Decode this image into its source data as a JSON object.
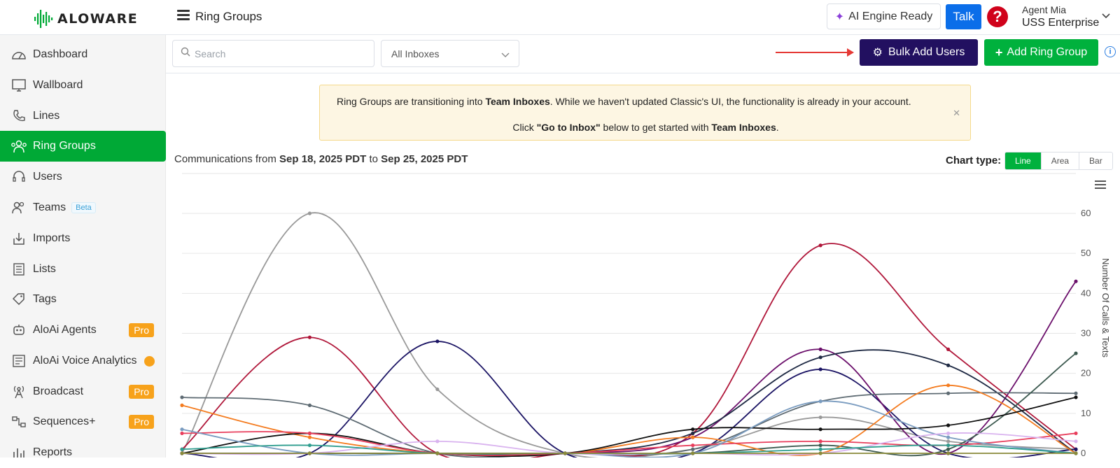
{
  "app": {
    "logo_text": "ALOWARE",
    "page_title": "Ring Groups"
  },
  "header": {
    "ai_status": "AI Engine Ready",
    "talk_label": "Talk",
    "agent_name": "Agent Mia",
    "agent_org": "USS Enterprise"
  },
  "sidebar": {
    "items": [
      {
        "label": "Dashboard",
        "icon": "dashboard-icon"
      },
      {
        "label": "Wallboard",
        "icon": "monitor-icon"
      },
      {
        "label": "Lines",
        "icon": "phone-icon"
      },
      {
        "label": "Ring Groups",
        "icon": "ring-groups-icon",
        "active": true
      },
      {
        "label": "Users",
        "icon": "headset-icon"
      },
      {
        "label": "Teams",
        "icon": "team-icon",
        "badge": "Beta"
      },
      {
        "label": "Imports",
        "icon": "import-icon"
      },
      {
        "label": "Lists",
        "icon": "list-icon"
      },
      {
        "label": "Tags",
        "icon": "tag-icon"
      },
      {
        "label": "AloAi Agents",
        "icon": "robot-icon",
        "badge": "Pro"
      },
      {
        "label": "AloAi Voice Analytics",
        "icon": "analytics-icon"
      },
      {
        "label": "Broadcast",
        "icon": "broadcast-icon",
        "badge": "Pro"
      },
      {
        "label": "Sequences+",
        "icon": "sequences-icon",
        "badge": "Pro"
      },
      {
        "label": "Reports",
        "icon": "reports-icon"
      }
    ]
  },
  "toolbar": {
    "search_placeholder": "Search",
    "inbox_filter": "All Inboxes",
    "bulk_add_label": "Bulk Add Users",
    "add_ring_group_label": "Add Ring Group"
  },
  "notice": {
    "line1_a": "Ring Groups are transitioning into ",
    "line1_b": "Team Inboxes",
    "line1_c": ". While we haven't updated Classic's UI, the functionality is already in your account.",
    "line2_a": "Click ",
    "line2_b": "\"Go to Inbox\"",
    "line2_c": " below to get started with ",
    "line2_d": "Team Inboxes",
    "line2_e": "."
  },
  "range": {
    "prefix": "Communications from ",
    "from": "Sep 18, 2025 PDT",
    "mid": " to ",
    "to": "Sep 25, 2025 PDT"
  },
  "chart_type": {
    "label": "Chart type:",
    "options": [
      "Line",
      "Area",
      "Bar"
    ],
    "selected": "Line"
  },
  "chart_data": {
    "type": "line",
    "ylabel": "Number Of Calls & Texts",
    "ylim": [
      0,
      60
    ],
    "yticks": [
      0,
      10,
      20,
      30,
      40,
      50,
      60
    ],
    "x": [
      0,
      1,
      2,
      3,
      4,
      5,
      6,
      7
    ],
    "series": [
      {
        "color": "#999999",
        "values": [
          0,
          60,
          16,
          0,
          1,
          9,
          3,
          1
        ]
      },
      {
        "color": "#b0173a",
        "values": [
          1,
          29,
          0,
          0,
          5,
          52,
          26,
          1
        ]
      },
      {
        "color": "#1b1464",
        "values": [
          0,
          0,
          28,
          0,
          0,
          21,
          0,
          1
        ]
      },
      {
        "color": "#6b0f6b",
        "values": [
          0,
          0,
          0,
          0,
          4,
          26,
          0,
          43
        ]
      },
      {
        "color": "#1f2a44",
        "values": [
          0,
          0,
          0,
          0,
          5,
          24,
          22,
          0
        ]
      },
      {
        "color": "#5e6b73",
        "values": [
          14,
          12,
          0,
          0,
          1,
          13,
          15,
          15
        ]
      },
      {
        "color": "#3d5a50",
        "values": [
          0,
          0,
          0,
          0,
          0,
          2,
          1,
          25
        ]
      },
      {
        "color": "#f47c20",
        "values": [
          12,
          4,
          0,
          0,
          4,
          0,
          17,
          0
        ]
      },
      {
        "color": "#111111",
        "values": [
          0,
          5,
          0,
          0,
          6,
          6,
          7,
          14
        ]
      },
      {
        "color": "#e83e5c",
        "values": [
          5,
          5,
          0,
          0,
          2,
          3,
          2,
          5
        ]
      },
      {
        "color": "#7a9cc0",
        "values": [
          6,
          0,
          0,
          0,
          0,
          13,
          4,
          0
        ]
      },
      {
        "color": "#d9b3ef",
        "values": [
          0,
          0,
          3,
          0,
          0,
          0,
          5,
          3
        ]
      },
      {
        "color": "#2f9e8f",
        "values": [
          1,
          2,
          0,
          0,
          0,
          1,
          2,
          0
        ]
      },
      {
        "color": "#8a8a3a",
        "values": [
          0,
          0,
          0,
          0,
          0,
          0,
          0,
          0
        ]
      }
    ]
  }
}
